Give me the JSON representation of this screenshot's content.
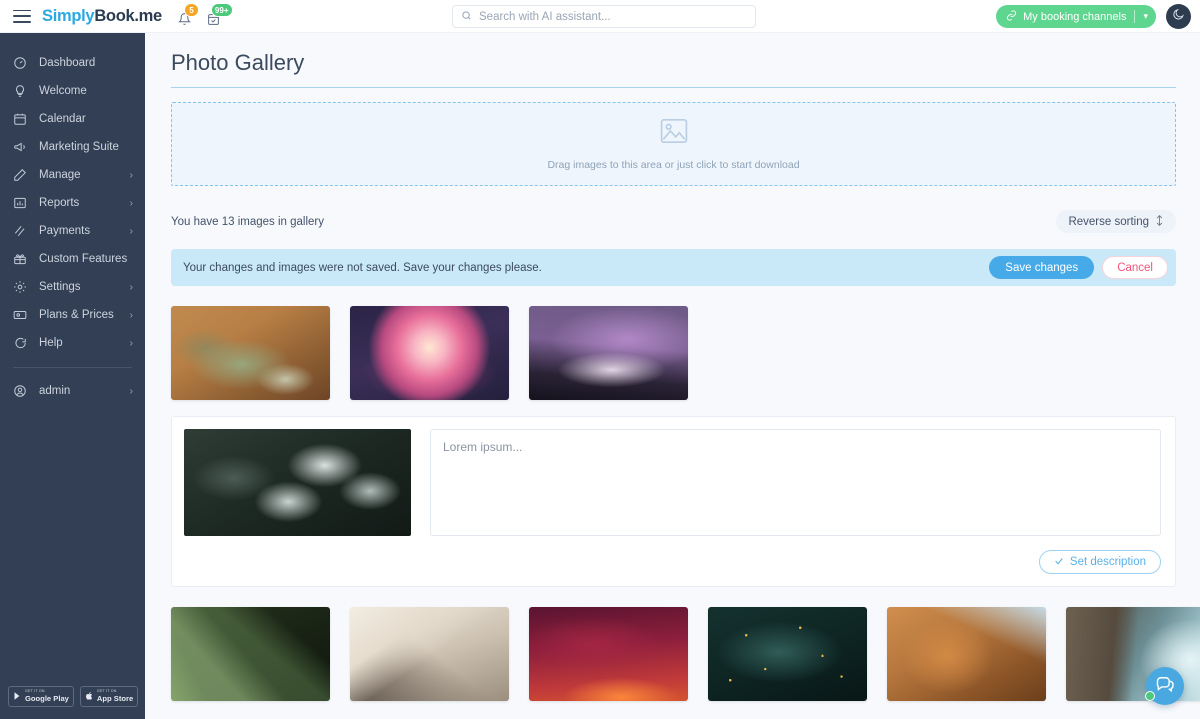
{
  "header": {
    "logo_simply": "Simply",
    "logo_book": "Book",
    "logo_me": ".me",
    "menu_icon": "hamburger-menu-icon",
    "notifications_badge": "5",
    "tasks_badge": "99+",
    "search": {
      "placeholder": "Search with AI assistant...",
      "value": ""
    },
    "booking_button_label": "My booking channels",
    "booking_button_color": "#5fd68f",
    "theme_toggle_icon": "moon-icon"
  },
  "sidebar": {
    "background": "#333f54",
    "items": [
      {
        "label": "Dashboard",
        "icon": "dashboard-icon",
        "chevron": false
      },
      {
        "label": "Welcome",
        "icon": "lightbulb-icon",
        "chevron": false
      },
      {
        "label": "Calendar",
        "icon": "calendar-icon",
        "chevron": false
      },
      {
        "label": "Marketing Suite",
        "icon": "megaphone-icon",
        "chevron": false
      },
      {
        "label": "Manage",
        "icon": "pencil-icon",
        "chevron": true
      },
      {
        "label": "Reports",
        "icon": "bar-chart-icon",
        "chevron": true
      },
      {
        "label": "Payments",
        "icon": "money-icon",
        "chevron": true
      },
      {
        "label": "Custom Features",
        "icon": "gift-icon",
        "chevron": false
      },
      {
        "label": "Settings",
        "icon": "gear-icon",
        "chevron": true
      },
      {
        "label": "Plans & Prices",
        "icon": "banknote-icon",
        "chevron": true
      },
      {
        "label": "Help",
        "icon": "chat-bubble-icon",
        "chevron": true
      }
    ],
    "account": {
      "label": "admin",
      "icon": "user-circle-icon",
      "chevron": true
    },
    "store_badges": [
      {
        "top": "GET IT ON",
        "name": "Google Play",
        "icon": "google-play-icon"
      },
      {
        "top": "GET IT ON",
        "name": "App Store",
        "icon": "apple-icon"
      }
    ]
  },
  "main": {
    "page_title": "Photo Gallery",
    "dropzone": {
      "icon": "image-placeholder-icon",
      "text": "Drag images to this area or just click to start download"
    },
    "gallery_count_text": "You have 13 images in gallery",
    "sort_button_label": "Reverse sorting",
    "sort_button_icon": "sort-arrows-icon",
    "alert": {
      "message": "Your changes and images were not saved. Save your changes please.",
      "save_label": "Save changes",
      "cancel_label": "Cancel",
      "background": "#c9e9f8",
      "save_color": "#46a9e8",
      "cancel_color": "#f0557a"
    },
    "editor": {
      "description_placeholder": "Lorem ipsum...",
      "description_value": "",
      "set_description_label": "Set description",
      "set_description_icon": "check-icon",
      "selected_image_alt": "frost-covered-leaves"
    },
    "thumbnails_top": [
      {
        "alt": "desert-shrubs-on-orange-sand"
      },
      {
        "alt": "pink-dahlia-flower-on-dark-purple"
      },
      {
        "alt": "purple-lightning-over-dark-horizon"
      }
    ],
    "thumbnails_bottom": [
      {
        "alt": "dewdrops-on-green-grass-blades"
      },
      {
        "alt": "misty-sepia-mountain-ridge-with-lone-tree"
      },
      {
        "alt": "crimson-red-sunset-clouds"
      },
      {
        "alt": "dark-teal-pine-branches-with-golden-lights"
      },
      {
        "alt": "curved-wooden-architecture-interior"
      },
      {
        "alt": "rocky-cliff-with-turquoise-ocean-surf"
      }
    ]
  },
  "chat_widget": {
    "icon": "chat-bubbles-icon",
    "status": "online",
    "color": "#4aa8e0"
  }
}
